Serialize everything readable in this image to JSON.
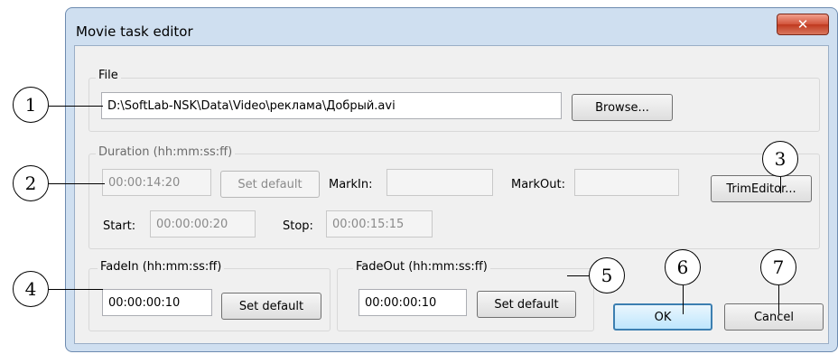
{
  "window": {
    "title": "Movie task editor",
    "close_icon": "close-icon"
  },
  "file_group": {
    "legend": "File",
    "path": "D:\\SoftLab-NSK\\Data\\Video\\реклама\\Добрый.avi",
    "browse_label": "Browse..."
  },
  "duration_group": {
    "legend": "Duration (hh:mm:ss:ff)",
    "duration": "00:00:14:20",
    "set_default_label": "Set default",
    "markin_label": "MarkIn:",
    "markin_value": "",
    "markout_label": "MarkOut:",
    "markout_value": "",
    "trimeditor_label": "TrimEditor...",
    "start_label": "Start:",
    "start_value": "00:00:00:20",
    "stop_label": "Stop:",
    "stop_value": "00:00:15:15"
  },
  "fadein_group": {
    "legend": "FadeIn (hh:mm:ss:ff)",
    "value": "00:00:00:10",
    "set_default_label": "Set default"
  },
  "fadeout_group": {
    "legend": "FadeOut (hh:mm:ss:ff)",
    "value": "00:00:00:10",
    "set_default_label": "Set default"
  },
  "buttons": {
    "ok_label": "OK",
    "cancel_label": "Cancel"
  },
  "callouts": [
    "1",
    "2",
    "3",
    "4",
    "5",
    "6",
    "7"
  ]
}
